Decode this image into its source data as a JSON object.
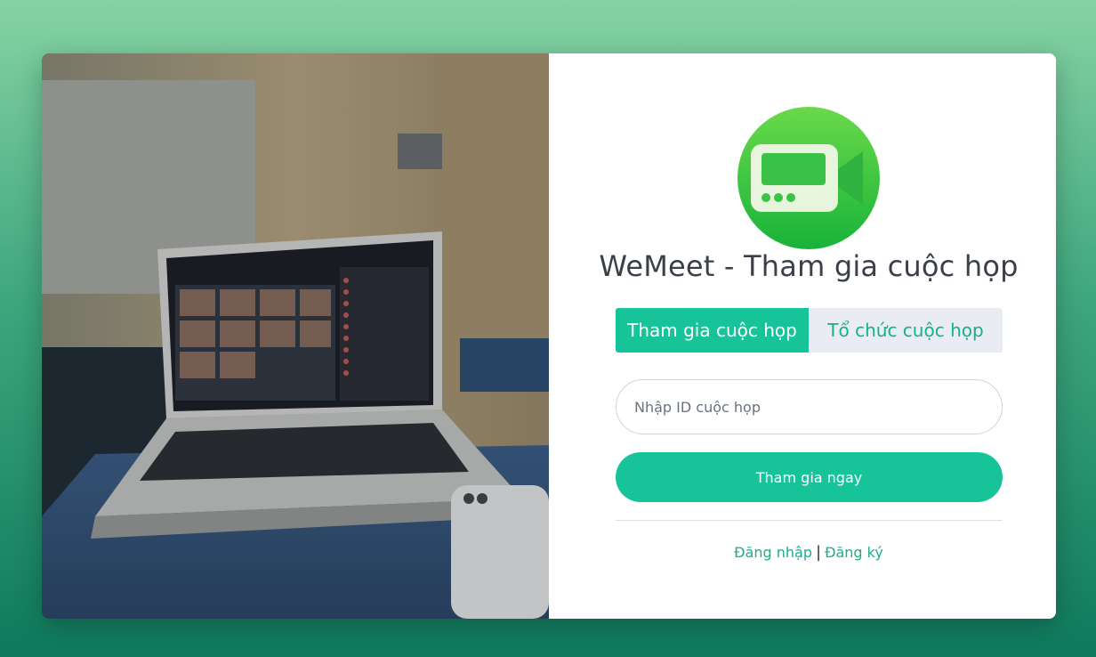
{
  "app": {
    "title": "WeMeet - Tham gia cuộc họp"
  },
  "tabs": [
    {
      "label": "Tham gia cuộc họp",
      "active": true
    },
    {
      "label": "Tổ chức cuộc họp",
      "active": false
    }
  ],
  "form": {
    "meeting_id_placeholder": "Nhập ID cuộc họp",
    "meeting_id_value": "",
    "join_button_label": "Tham gia ngay"
  },
  "auth": {
    "login_label": "Đăng nhập",
    "separator": "|",
    "register_label": "Đăng ký"
  },
  "icons": {
    "logo": "video-camera-icon"
  },
  "colors": {
    "accent": "#17c49a",
    "tab_inactive_bg": "#e9ecf3",
    "title": "#3b3f4a"
  }
}
